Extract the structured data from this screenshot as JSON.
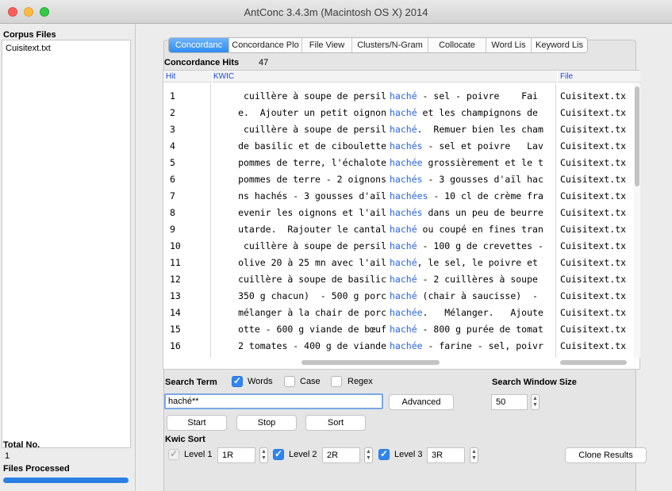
{
  "window": {
    "title": "AntConc 3.4.3m (Macintosh OS X) 2014"
  },
  "left": {
    "corpus_files_label": "Corpus Files",
    "files": [
      "Cuisitext.txt"
    ],
    "total_label": "Total No.",
    "total_value": "1",
    "processed_label": "Files Processed",
    "progress": 1.0
  },
  "tabs": [
    {
      "label": "Concordanc",
      "active": true
    },
    {
      "label": "Concordance Plo",
      "active": false
    },
    {
      "label": "File View",
      "active": false
    },
    {
      "label": "Clusters/N-Gram",
      "active": false
    },
    {
      "label": "Collocate",
      "active": false
    },
    {
      "label": "Word Lis",
      "active": false
    },
    {
      "label": "Keyword Lis",
      "active": false
    }
  ],
  "hits": {
    "label": "Concordance Hits",
    "count": "47"
  },
  "table": {
    "col_hit": "Hit",
    "col_kwic": "KWIC",
    "col_file": "File",
    "rows": [
      {
        "hit": "1",
        "left": "cuillère à soupe de persil",
        "kw": "haché",
        "right": " - sel - poivre    Fai",
        "file": "Cuisitext.tx"
      },
      {
        "hit": "2",
        "left": "e.  Ajouter un petit oignon",
        "kw": "haché",
        "right": " et les champignons de",
        "file": "Cuisitext.tx"
      },
      {
        "hit": "3",
        "left": "cuillère à soupe de persil",
        "kw": "haché",
        "right": ".  Remuer bien les cham",
        "file": "Cuisitext.tx"
      },
      {
        "hit": "4",
        "left": "de basilic et de ciboulette",
        "kw": "hachés",
        "right": " - sel et poivre   Lav",
        "file": "Cuisitext.tx"
      },
      {
        "hit": "5",
        "left": "pommes de terre, l'échalote",
        "kw": "hachée",
        "right": " grossièrement et le t",
        "file": "Cuisitext.tx"
      },
      {
        "hit": "6",
        "left": "pommes de terre - 2 oignons",
        "kw": "hachés",
        "right": " - 3 gousses d'aïl hac",
        "file": "Cuisitext.tx"
      },
      {
        "hit": "7",
        "left": "ns hachés - 3 gousses d'aïl",
        "kw": "hachées",
        "right": " - 10 cl de crème fra",
        "file": "Cuisitext.tx"
      },
      {
        "hit": "8",
        "left": "evenir les oignons et l'ail",
        "kw": "hachés",
        "right": " dans un peu de beurre",
        "file": "Cuisitext.tx"
      },
      {
        "hit": "9",
        "left": "utarde.  Rajouter le cantal",
        "kw": "haché",
        "right": " ou coupé en fines tran",
        "file": "Cuisitext.tx"
      },
      {
        "hit": "10",
        "left": "cuillère à soupe de persil",
        "kw": "haché",
        "right": " - 100 g de crevettes -",
        "file": "Cuisitext.tx"
      },
      {
        "hit": "11",
        "left": "olive 20 à 25 mn avec l'ail",
        "kw": "haché",
        "right": ", le sel, le poivre et",
        "file": "Cuisitext.tx"
      },
      {
        "hit": "12",
        "left": "cuillère à soupe de basilic",
        "kw": "haché",
        "right": " - 2 cuillères à soupe",
        "file": "Cuisitext.tx"
      },
      {
        "hit": "13",
        "left": "350 g chacun)  - 500 g porc",
        "kw": "haché",
        "right": " (chair à saucisse)  -",
        "file": "Cuisitext.tx"
      },
      {
        "hit": "14",
        "left": "mélanger à la chair de porc",
        "kw": "hachée",
        "right": ".   Mélanger.   Ajoute",
        "file": "Cuisitext.tx"
      },
      {
        "hit": "15",
        "left": "otte - 600 g viande de bœuf",
        "kw": "haché",
        "right": " - 800 g purée de tomat",
        "file": "Cuisitext.tx"
      },
      {
        "hit": "16",
        "left": "2 tomates - 400 g de viande",
        "kw": "hachée",
        "right": " - farine - sel, poivr",
        "file": "Cuisitext.tx"
      }
    ]
  },
  "search": {
    "term_label": "Search Term",
    "words_label": "Words",
    "case_label": "Case",
    "regex_label": "Regex",
    "words_checked": true,
    "case_checked": false,
    "regex_checked": false,
    "value": "haché**",
    "advanced_label": "Advanced",
    "start_label": "Start",
    "stop_label": "Stop",
    "sort_label": "Sort",
    "window_size_label": "Search Window Size",
    "window_size_value": "50"
  },
  "kwic_sort": {
    "label": "Kwic Sort",
    "levels": [
      {
        "label": "Level 1",
        "value": "1R",
        "checked": false
      },
      {
        "label": "Level 2",
        "value": "2R",
        "checked": true
      },
      {
        "label": "Level 3",
        "value": "3R",
        "checked": true
      }
    ],
    "clone_label": "Clone Results"
  }
}
